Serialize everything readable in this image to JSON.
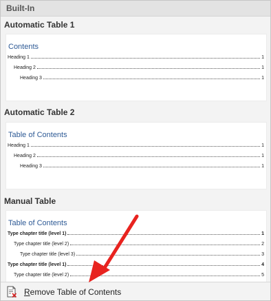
{
  "header": {
    "label": "Built-In"
  },
  "gallery": [
    {
      "title": "Automatic Table 1",
      "preview_title": "Contents",
      "lines": [
        {
          "label": "Heading 1",
          "page": "1",
          "level": 1,
          "bold": false
        },
        {
          "label": "Heading 2",
          "page": "1",
          "level": 2,
          "bold": false
        },
        {
          "label": "Heading 3",
          "page": "1",
          "level": 3,
          "bold": false
        }
      ]
    },
    {
      "title": "Automatic Table 2",
      "preview_title": "Table of Contents",
      "lines": [
        {
          "label": "Heading 1",
          "page": "1",
          "level": 1,
          "bold": false
        },
        {
          "label": "Heading 2",
          "page": "1",
          "level": 2,
          "bold": false
        },
        {
          "label": "Heading 3",
          "page": "1",
          "level": 3,
          "bold": false
        }
      ]
    },
    {
      "title": "Manual Table",
      "preview_title": "Table of Contents",
      "lines": [
        {
          "label": "Type chapter title (level 1)",
          "page": "1",
          "level": 1,
          "bold": true
        },
        {
          "label": "Type chapter title (level 2)",
          "page": "2",
          "level": 2,
          "bold": false
        },
        {
          "label": "Type chapter title (level 3)",
          "page": "3",
          "level": 3,
          "bold": false
        },
        {
          "label": "Type chapter title (level 1)",
          "page": "4",
          "level": 1,
          "bold": true
        },
        {
          "label": "Type chapter title (level 2)",
          "page": "5",
          "level": 2,
          "bold": false
        }
      ]
    }
  ],
  "footer": {
    "remove_access_key": "R",
    "remove_rest": "emove Table of Contents",
    "icon": "remove-toc-icon"
  },
  "colors": {
    "accent_title": "#2e5a95",
    "arrow": "#e8231f"
  }
}
